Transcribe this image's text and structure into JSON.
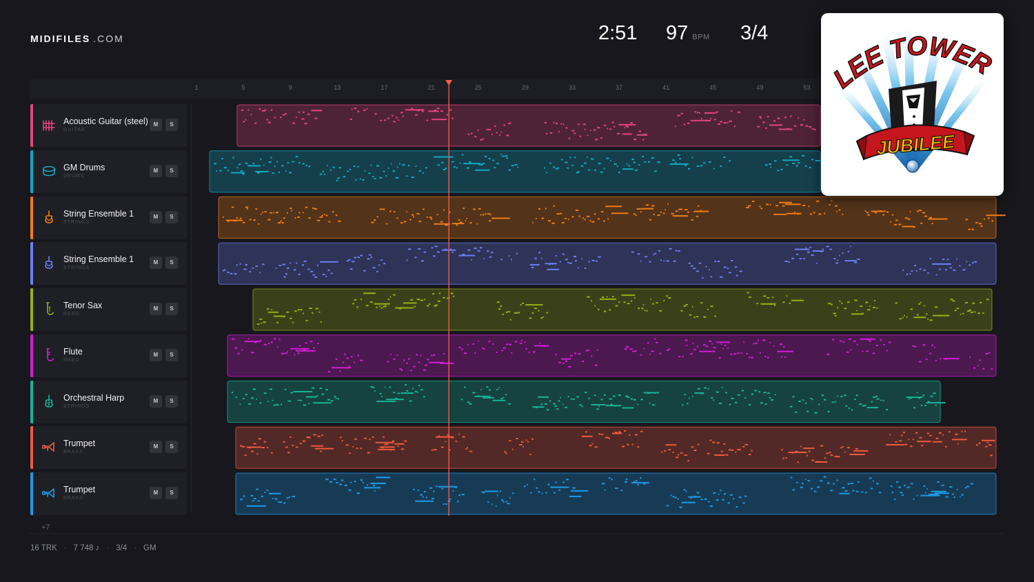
{
  "brand": {
    "name": "MIDIFILES",
    "suffix": ".COM"
  },
  "stats": {
    "duration": "2:51",
    "bpm": "97",
    "bpm_unit": "BPM",
    "time_signature": "3/4"
  },
  "album": {
    "line1": "LEE TOWERS",
    "line2": "JUBILEE"
  },
  "ruler": {
    "labels": [
      "1",
      "5",
      "9",
      "13",
      "17",
      "21",
      "25",
      "29",
      "33",
      "37",
      "41",
      "45",
      "49",
      "53"
    ]
  },
  "playhead": {
    "bar": 22.5
  },
  "tracks": [
    {
      "name": "Acoustic Guitar (steel)",
      "category": "GUITAR",
      "icon": "guitar-icon",
      "color": "#e4467f",
      "mute": "M",
      "solo": "S"
    },
    {
      "name": "GM Drums",
      "category": "DRUMS",
      "icon": "drum-icon",
      "color": "#13a9c4",
      "mute": "M",
      "solo": "S"
    },
    {
      "name": "String Ensemble 1",
      "category": "STRINGS",
      "icon": "violin-icon",
      "color": "#ef7d16",
      "mute": "M",
      "solo": "S"
    },
    {
      "name": "String Ensemble 1",
      "category": "STRINGS",
      "icon": "violin-icon",
      "color": "#6c7ff2",
      "mute": "M",
      "solo": "S"
    },
    {
      "name": "Tenor Sax",
      "category": "REED",
      "icon": "sax-icon",
      "color": "#98b014",
      "mute": "M",
      "solo": "S"
    },
    {
      "name": "Flute",
      "category": "REED",
      "icon": "flute-icon",
      "color": "#d31ed6",
      "mute": "M",
      "solo": "S"
    },
    {
      "name": "Orchestral Harp",
      "category": "STRINGS",
      "icon": "harp-icon",
      "color": "#17b49a",
      "mute": "M",
      "solo": "S"
    },
    {
      "name": "Trumpet",
      "category": "BRASS",
      "icon": "trumpet-icon",
      "color": "#ee5a3f",
      "mute": "M",
      "solo": "S"
    },
    {
      "name": "Trumpet",
      "category": "BRASS",
      "icon": "trumpet-icon",
      "color": "#1e9ae8",
      "mute": "M",
      "solo": "S"
    }
  ],
  "more_tracks": "+7",
  "footer": {
    "tracks": "16 TRK",
    "notes": "7 748 ♪",
    "time_signature": "3/4",
    "standard": "GM"
  }
}
